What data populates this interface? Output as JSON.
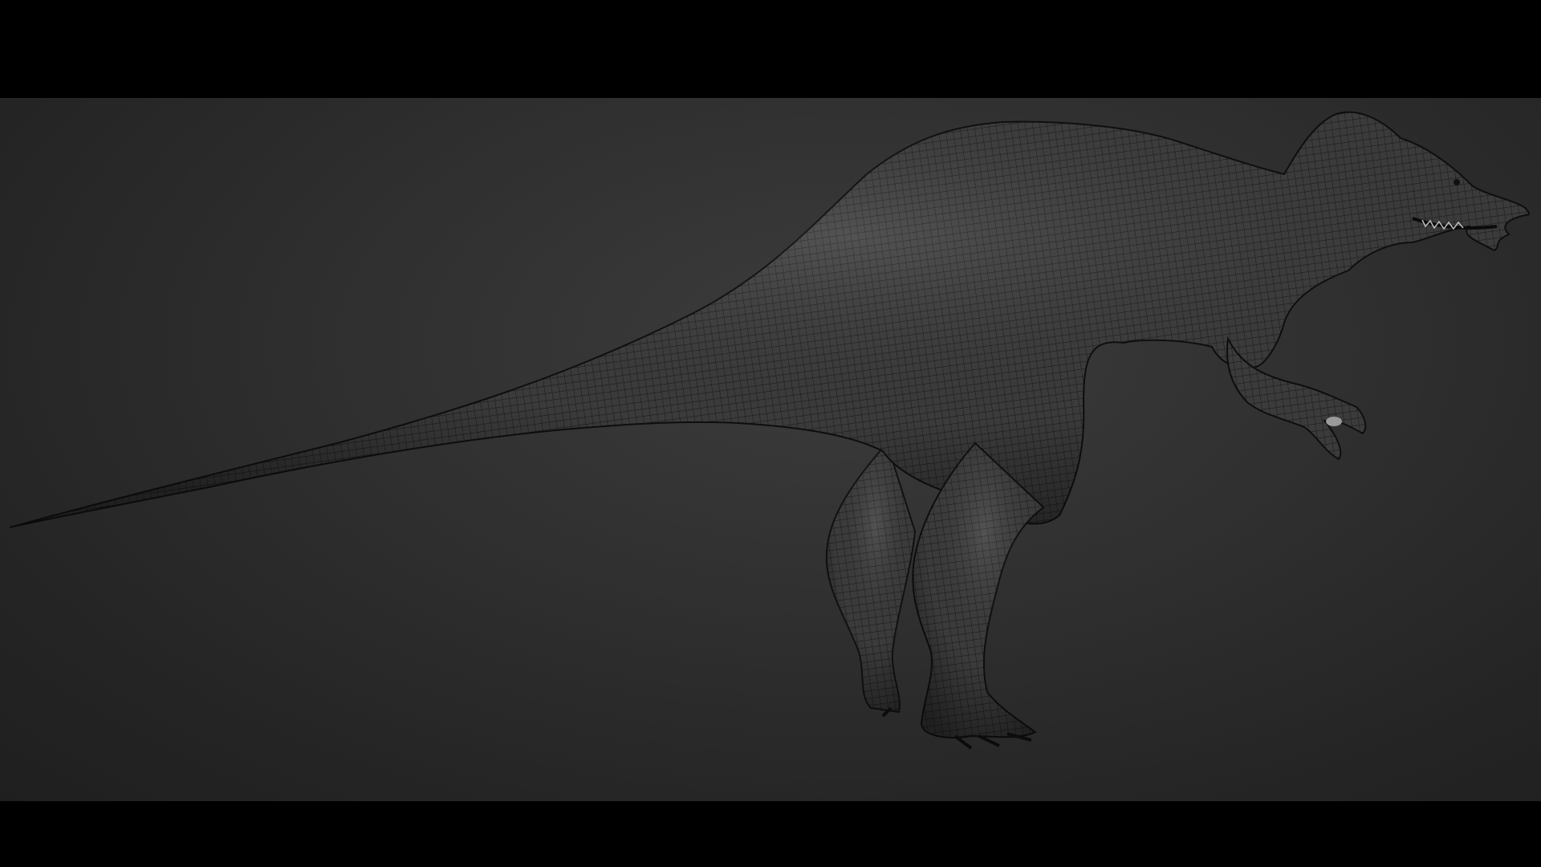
{
  "app": {
    "viewport_background": "#2f2f2f",
    "letterbox_color": "#000000"
  },
  "model": {
    "icon": "dinosaur-wireframe-mesh",
    "mesh_fill": "#3a3a3a",
    "mesh_line": "#141414"
  }
}
